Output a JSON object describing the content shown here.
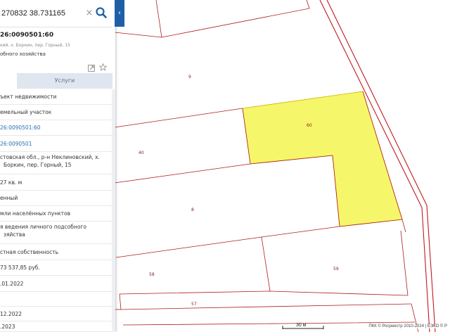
{
  "search": {
    "value": "270832 38.731165",
    "clear_glyph": "×"
  },
  "panel": {
    "collapse_glyph": "‹",
    "cadastral_number": "26:0090501:60",
    "address_short": "кий, х. Боркин, пер. Горный, 15",
    "use_short": "обного хозяйства"
  },
  "tabs": {
    "services_label": "Услуги"
  },
  "rows": [
    {
      "text": "ъект недвижимости",
      "link": false
    },
    {
      "text": "емельный участок",
      "link": false
    },
    {
      "text": "26:0090501:60",
      "link": true
    },
    {
      "text": "26:0090501",
      "link": true
    },
    {
      "text": "стовская обл., р-н Неклиновский, х.",
      "text2": "Боркин, пер. Горный, 15",
      "link": false
    },
    {
      "text": "27 кв. м",
      "link": false
    },
    {
      "text": "енный",
      "link": false
    },
    {
      "text": "мли населённых пунктов",
      "link": false
    },
    {
      "text": "я ведения личного подсобного",
      "text2": "зяйства",
      "link": false
    },
    {
      "text": "стная собственность",
      "link": false
    },
    {
      "text": "73 537,85 руб.",
      "link": false
    },
    {
      "text": ".01.2022",
      "link": false
    },
    {
      "text": "",
      "link": false
    },
    {
      "text": "12.2022",
      "link": false
    },
    {
      "text": ".2023",
      "link": false
    }
  ],
  "map": {
    "parcel_labels": [
      "9",
      "60",
      "40",
      "8",
      "58",
      "59",
      "57"
    ],
    "highlight_color": "#f5f55a",
    "boundary_color": "#b01c1c",
    "scale_label": "30 м"
  },
  "attribution": "ПКК © Росреестр 2010-2024 | ЕЭКО © Р"
}
